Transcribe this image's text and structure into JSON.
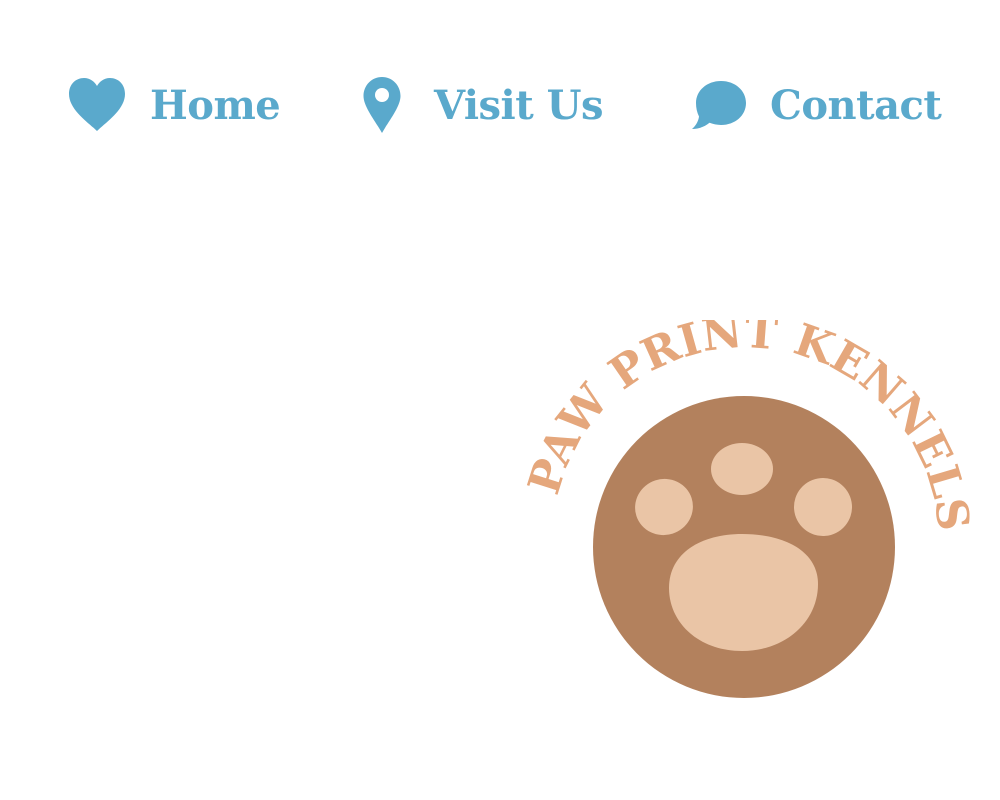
{
  "nav": {
    "items": [
      {
        "label": "Home",
        "icon": "heart-icon"
      },
      {
        "label": "Visit Us",
        "icon": "map-pin-icon"
      },
      {
        "label": "Contact",
        "icon": "speech-bubble-icon"
      }
    ]
  },
  "logo": {
    "text": "PAW PRINT KENNELS",
    "icon": "paw-print-icon"
  },
  "colors": {
    "nav_blue": "#5aa9cc",
    "logo_text": "#e5a77c",
    "circle": "#b3815d",
    "paw": "#eac5a6",
    "background": "#ffffff"
  }
}
